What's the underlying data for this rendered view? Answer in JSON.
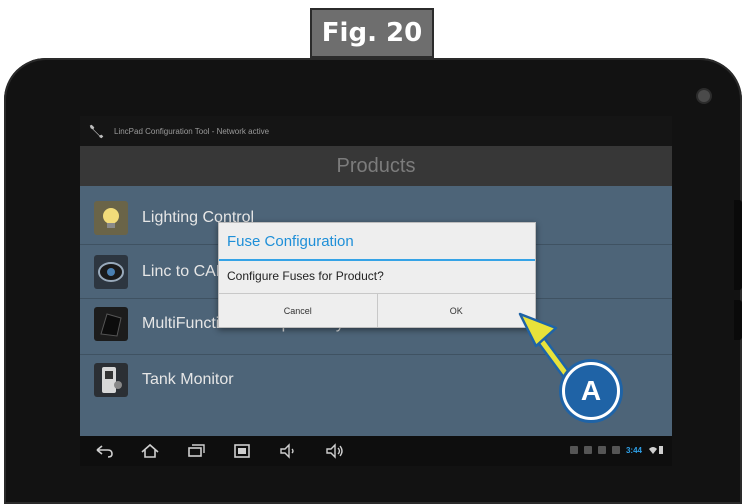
{
  "figure": {
    "label": "Fig. 20"
  },
  "app": {
    "status_title": "LincPad Configuration Tool - Network active",
    "screen_title": "Products"
  },
  "products": [
    {
      "label": "Lighting Control",
      "icon": "light-bulb-icon"
    },
    {
      "label": "Linc to CAN",
      "icon": "can-module-icon"
    },
    {
      "label": "MultiFunction 8-Output w/Hydraulic",
      "icon": "multifunction-module-icon"
    },
    {
      "label": "Tank Monitor",
      "icon": "tank-monitor-icon"
    }
  ],
  "dialog": {
    "title": "Fuse Configuration",
    "message": "Configure Fuses for Product?",
    "cancel_label": "Cancel",
    "ok_label": "OK"
  },
  "nav": {
    "icons": [
      "back-icon",
      "home-icon",
      "recent-apps-icon",
      "screenshot-icon",
      "volume-down-icon",
      "volume-up-icon"
    ],
    "clock": "3:44"
  },
  "callout": {
    "label": "A"
  },
  "colors": {
    "accent": "#35a3e6",
    "dialog_title": "#1e8fd8",
    "callout_fill": "#1f63a6",
    "arrow": "#e8e23a",
    "list_bg": "#4d6478"
  }
}
